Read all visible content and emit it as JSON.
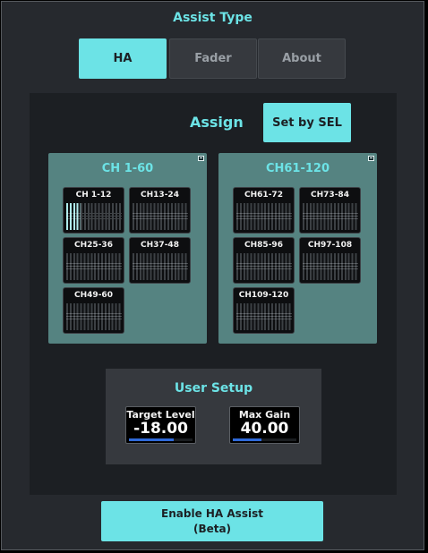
{
  "assist_type": {
    "title": "Assist Type",
    "tabs": [
      {
        "label": "HA",
        "active": true
      },
      {
        "label": "Fader",
        "active": false
      },
      {
        "label": "About",
        "active": false
      }
    ]
  },
  "assign": {
    "label": "Assign",
    "set_by_sel_label": "Set by SEL"
  },
  "groups": [
    {
      "title": "CH 1-60",
      "tiles": [
        "CH 1-12",
        "CH13-24",
        "CH25-36",
        "CH37-48",
        "CH49-60"
      ]
    },
    {
      "title": "CH61-120",
      "tiles": [
        "CH61-72",
        "CH73-84",
        "CH85-96",
        "CH97-108",
        "CH109-120"
      ]
    }
  ],
  "user_setup": {
    "title": "User Setup",
    "target_level": {
      "label": "Target Level",
      "value": "-18.00",
      "level_fraction": 0.7
    },
    "max_gain": {
      "label": "Max Gain",
      "value": "40.00",
      "level_fraction": 0.45
    }
  },
  "enable_button": {
    "line1": "Enable HA Assist",
    "line2": "(Beta)"
  },
  "colors": {
    "accent": "#6ce3e6",
    "group_bg": "#558381",
    "value_bar": "#2f6ad9"
  }
}
